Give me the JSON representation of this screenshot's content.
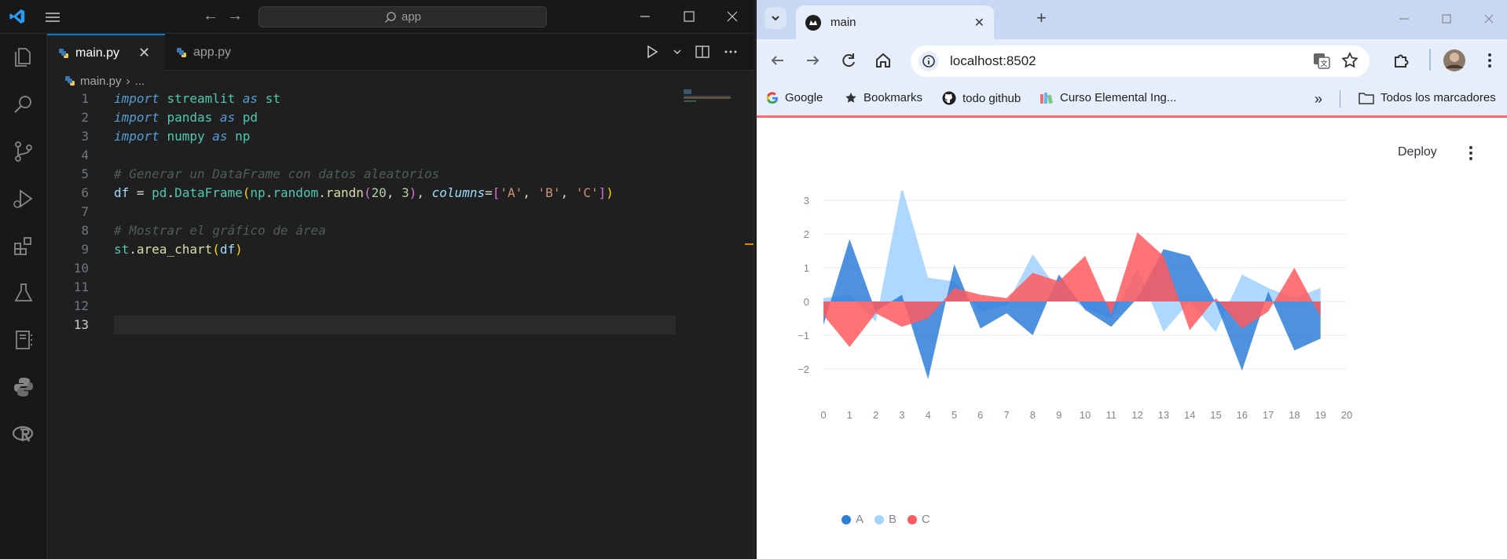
{
  "vscode": {
    "search_placeholder": "app",
    "tabs": [
      {
        "label": "main.py",
        "active": true
      },
      {
        "label": "app.py",
        "active": false
      }
    ],
    "breadcrumb": {
      "file": "main.py",
      "rest": "..."
    },
    "line_numbers": [
      "1",
      "2",
      "3",
      "4",
      "5",
      "6",
      "7",
      "8",
      "9",
      "10",
      "11",
      "12",
      "13"
    ],
    "current_line": 13,
    "code": {
      "l1": {
        "kw1": "import",
        "mod": "streamlit",
        "kw2": "as",
        "alias": "st"
      },
      "l2": {
        "kw1": "import",
        "mod": "pandas",
        "kw2": "as",
        "alias": "pd"
      },
      "l3": {
        "kw1": "import",
        "mod": "numpy",
        "kw2": "as",
        "alias": "np"
      },
      "l5": "# Generar un DataFrame con datos aleatorios",
      "l6": {
        "df": "df",
        "eq": " = ",
        "pd": "pd",
        "cls": "DataFrame",
        "np": "np",
        "random": "random",
        "fn": "randn",
        "n1": "20",
        "n2": "3",
        "kwarg": "columns",
        "a": "'A'",
        "b": "'B'",
        "c": "'C'"
      },
      "l8": "# Mostrar el gráfico de área",
      "l9": {
        "st": "st",
        "fn": "area_chart",
        "arg": "df"
      }
    }
  },
  "chrome": {
    "tab_title": "main",
    "url": "localhost:8502",
    "bookmarks": [
      "Google",
      "Bookmarks",
      "todo github",
      "Curso Elemental Ing...",
      "Todos los marcadores"
    ],
    "deploy_label": "Deploy"
  },
  "colors": {
    "A": "#2f7ed8",
    "B": "#a5d4ff",
    "C": "#ff5a5f",
    "accent": "#0078d4"
  },
  "chart_data": {
    "type": "area",
    "x": [
      0,
      1,
      2,
      3,
      4,
      5,
      6,
      7,
      8,
      9,
      10,
      11,
      12,
      13,
      14,
      15,
      16,
      17,
      18,
      19
    ],
    "xlim": [
      0,
      20
    ],
    "ylim": [
      -2.5,
      3.5
    ],
    "xticks": [
      "0",
      "1",
      "2",
      "3",
      "4",
      "5",
      "6",
      "7",
      "8",
      "9",
      "10",
      "11",
      "12",
      "13",
      "14",
      "15",
      "16",
      "17",
      "18",
      "19",
      "20"
    ],
    "yticks": [
      "3",
      "2",
      "1",
      "0",
      "−1",
      "−2"
    ],
    "ytick_values": [
      3,
      2,
      1,
      0,
      -1,
      -2
    ],
    "grid": true,
    "legend_position": "bottom-left",
    "series": [
      {
        "name": "B",
        "values": [
          0.1,
          0.2,
          -0.6,
          3.4,
          0.7,
          0.6,
          -0.3,
          -0.1,
          1.4,
          0.3,
          -0.2,
          -0.5,
          1.0,
          -0.9,
          0.0,
          -0.9,
          0.8,
          0.4,
          0.1,
          0.4
        ]
      },
      {
        "name": "A",
        "values": [
          -0.7,
          1.85,
          -0.3,
          0.2,
          -2.3,
          1.1,
          -0.8,
          -0.35,
          -1.0,
          0.8,
          -0.25,
          -0.75,
          0.1,
          1.55,
          1.35,
          -0.05,
          -2.05,
          0.3,
          -1.45,
          -1.1
        ]
      },
      {
        "name": "C",
        "values": [
          -0.4,
          -1.35,
          -0.35,
          -0.75,
          -0.5,
          0.4,
          0.2,
          0.1,
          0.85,
          0.6,
          1.35,
          -0.4,
          2.05,
          1.35,
          -0.85,
          0.1,
          -0.8,
          -0.3,
          1.0,
          -0.45
        ]
      }
    ]
  }
}
